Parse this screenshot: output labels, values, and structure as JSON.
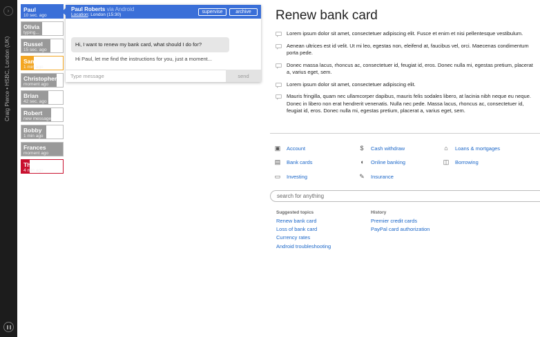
{
  "sidebar": {
    "top_button_glyph": "›",
    "vertical_text": "Craig Pierce • HSBC, London (UK)",
    "pause_icon": "pause-icon"
  },
  "chats": [
    {
      "name": "Paul",
      "sub": "10 sec. ago",
      "state": "active",
      "fill": 1.0
    },
    {
      "name": "Olivia",
      "sub": "typing...",
      "state": "normal",
      "fill": 0.5
    },
    {
      "name": "Russel",
      "sub": "15 sec. ago",
      "state": "normal",
      "fill": 0.7
    },
    {
      "name": "Samuel",
      "sub": "1 min ago",
      "state": "orange",
      "fill": 0.3
    },
    {
      "name": "Christopher",
      "sub": "moment ago",
      "state": "normal",
      "fill": 0.85
    },
    {
      "name": "Brian",
      "sub": "42 sec. ago",
      "state": "normal",
      "fill": 0.65
    },
    {
      "name": "Robert",
      "sub": "new message",
      "state": "normal",
      "fill": 0.72
    },
    {
      "name": "Bobby",
      "sub": "1 min ago",
      "state": "normal",
      "fill": 0.6
    },
    {
      "name": "Frances",
      "sub": "moment ago",
      "state": "normal",
      "fill": 1.0
    },
    {
      "name": "Thomas",
      "sub": "4 min ago",
      "state": "red",
      "fill": 0.2
    }
  ],
  "chat": {
    "name": "Paul Roberts",
    "via": "via Android",
    "location_label": "Location",
    "location_value": ": London (15:30)",
    "supervise_label": "supervise",
    "archive_label": "archive",
    "customer_message": "Hi, I want to renew my bank card, what should I do for?",
    "agent_reply": "Hi Paul, let me find the instructions for you, just a moment...",
    "input_placeholder": "Type message",
    "send_label": "send"
  },
  "article": {
    "title": "Renew bank card",
    "paragraphs": [
      "Lorem ipsum dolor sit amet, consectetuer adipiscing elit. Fusce et enim et nisi pellentesque vestibulum.",
      "Aenean ultrices est id velit. Ut mi leo, egestas non, eleifend at, faucibus vel, orci. Maecenas condimentum porta pede.",
      "Donec massa lacus, rhoncus ac, consectetuer id, feugiat id, eros. Donec nulla mi, egestas pretium, placerat a, varius eget, sem.",
      "Lorem ipsum dolor sit amet, consectetuer adipiscing elit.",
      "Mauris fringilla, quam nec ullamcorper dapibus, mauris felis sodales libero, at lacinia nibh neque eu neque. Donec in libero non erat hendrerit venenatis. Nulla nec pede. Massa lacus, rhoncus ac, consectetuer id, feugiat id, eros. Donec nulla mi, egestas pretium, placerat a, varius eget, sem."
    ]
  },
  "categories": [
    {
      "label": "Account",
      "icon": "safe-icon",
      "glyph": "▣"
    },
    {
      "label": "Cash withdraw",
      "icon": "cash-icon",
      "glyph": "$"
    },
    {
      "label": "Loans & mortgages",
      "icon": "house-icon",
      "glyph": "⌂"
    },
    {
      "label": "Bank cards",
      "icon": "cards-icon",
      "glyph": "▤"
    },
    {
      "label": "Online banking",
      "icon": "mouse-icon",
      "glyph": "◖"
    },
    {
      "label": "Borrowing",
      "icon": "wallet-icon",
      "glyph": "◫"
    },
    {
      "label": "Investing",
      "icon": "briefcase-icon",
      "glyph": "▭"
    },
    {
      "label": "Insurance",
      "icon": "document-icon",
      "glyph": "✎"
    }
  ],
  "search": {
    "placeholder": "search for anything"
  },
  "suggested": {
    "heading": "Suggested topics",
    "items": [
      "Renew bank card",
      "Loss of bank card",
      "Currency rates",
      "Android troubleshooting"
    ]
  },
  "history": {
    "heading": "History",
    "items": [
      "Premier credit cards",
      "PayPal card authorization"
    ]
  }
}
